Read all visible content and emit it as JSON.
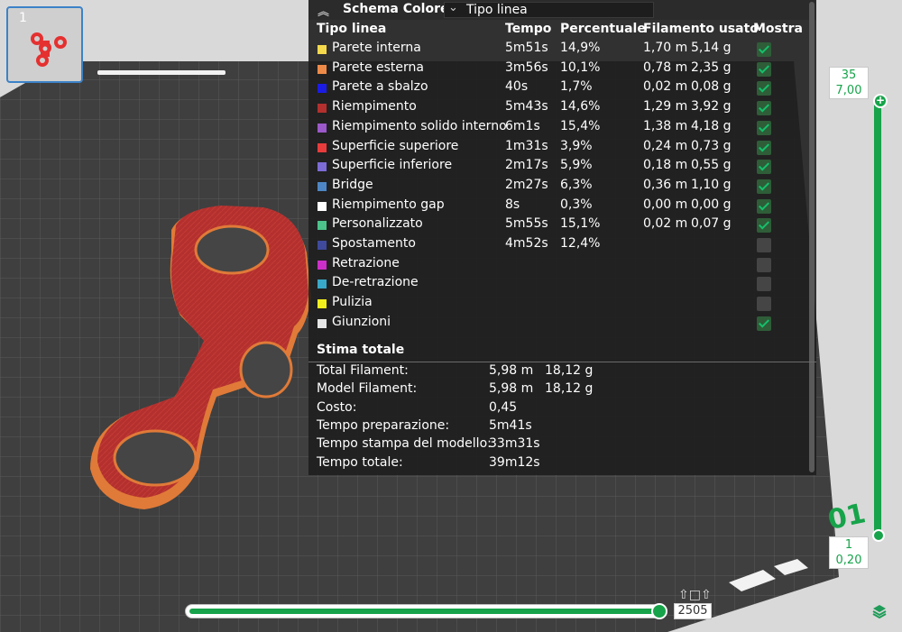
{
  "thumbnail": {
    "plate_number": "1"
  },
  "legend": {
    "scheme_title": "Schema Colore",
    "view_type": "Tipo linea",
    "columns": [
      "Tipo linea",
      "Tempo",
      "Percentuale",
      "Filamento usato",
      "Mostra"
    ],
    "rows": [
      {
        "color": "#f5d94c",
        "name": "Parete interna",
        "time": "5m51s",
        "pct": "14,9%",
        "len": "1,70 m",
        "weight": "5,14 g",
        "show": true
      },
      {
        "color": "#ee8a48",
        "name": "Parete esterna",
        "time": "3m56s",
        "pct": "10,1%",
        "len": "0,78 m",
        "weight": "2,35 g",
        "show": true
      },
      {
        "color": "#1b1be6",
        "name": "Parete a sbalzo",
        "time": "40s",
        "pct": "1,7%",
        "len": "0,02 m",
        "weight": "0,08 g",
        "show": true
      },
      {
        "color": "#b3302e",
        "name": "Riempimento",
        "time": "5m43s",
        "pct": "14,6%",
        "len": "1,29 m",
        "weight": "3,92 g",
        "show": true
      },
      {
        "color": "#9b59c9",
        "name": "Riempimento solido interno",
        "time": "6m1s",
        "pct": "15,4%",
        "len": "1,38 m",
        "weight": "4,18 g",
        "show": true
      },
      {
        "color": "#e83b3b",
        "name": "Superficie superiore",
        "time": "1m31s",
        "pct": "3,9%",
        "len": "0,24 m",
        "weight": "0,73 g",
        "show": true
      },
      {
        "color": "#7d6bd6",
        "name": "Superficie inferiore",
        "time": "2m17s",
        "pct": "5,9%",
        "len": "0,18 m",
        "weight": "0,55 g",
        "show": true
      },
      {
        "color": "#4e86c5",
        "name": "Bridge",
        "time": "2m27s",
        "pct": "6,3%",
        "len": "0,36 m",
        "weight": "1,10 g",
        "show": true
      },
      {
        "color": "#ffffff",
        "name": "Riempimento gap",
        "time": "8s",
        "pct": "0,3%",
        "len": "0,00 m",
        "weight": "0,00 g",
        "show": true
      },
      {
        "color": "#4cc38a",
        "name": "Personalizzato",
        "time": "5m55s",
        "pct": "15,1%",
        "len": "0,02 m",
        "weight": "0,07 g",
        "show": true
      },
      {
        "color": "#3f4a9c",
        "name": "Spostamento",
        "time": "4m52s",
        "pct": "12,4%",
        "len": "",
        "weight": "",
        "show": false
      },
      {
        "color": "#cc2fc9",
        "name": "Retrazione",
        "time": "",
        "pct": "",
        "len": "",
        "weight": "",
        "show": false
      },
      {
        "color": "#39a9c9",
        "name": "De-retrazione",
        "time": "",
        "pct": "",
        "len": "",
        "weight": "",
        "show": false
      },
      {
        "color": "#f2f01c",
        "name": "Pulizia",
        "time": "",
        "pct": "",
        "len": "",
        "weight": "",
        "show": false
      },
      {
        "color": "#e6e6e6",
        "name": "Giunzioni",
        "time": "",
        "pct": "",
        "len": "",
        "weight": "",
        "show": true
      }
    ],
    "estimate_title": "Stima totale",
    "estimate": [
      {
        "label": "Total Filament:",
        "v1": "5,98 m",
        "v2": "18,12 g"
      },
      {
        "label": "Model Filament:",
        "v1": "5,98 m",
        "v2": "18,12 g"
      },
      {
        "label": "Costo:",
        "v1": "0,45",
        "v2": ""
      },
      {
        "label": "Tempo preparazione:",
        "v1": "5m41s",
        "v2": ""
      },
      {
        "label": "Tempo stampa del modello:",
        "v1": "33m31s",
        "v2": ""
      },
      {
        "label": "Tempo totale:",
        "v1": "39m12s",
        "v2": ""
      }
    ]
  },
  "layer_slider": {
    "top_layer": "35",
    "top_height": "7,00",
    "bottom_layer": "1",
    "bottom_height": "0,20"
  },
  "move_slider": {
    "value": "2505"
  },
  "plate_label": "01",
  "colors": {
    "accent": "#17a34a",
    "model_red": "#b3302e",
    "model_orange": "#ee8a48"
  }
}
